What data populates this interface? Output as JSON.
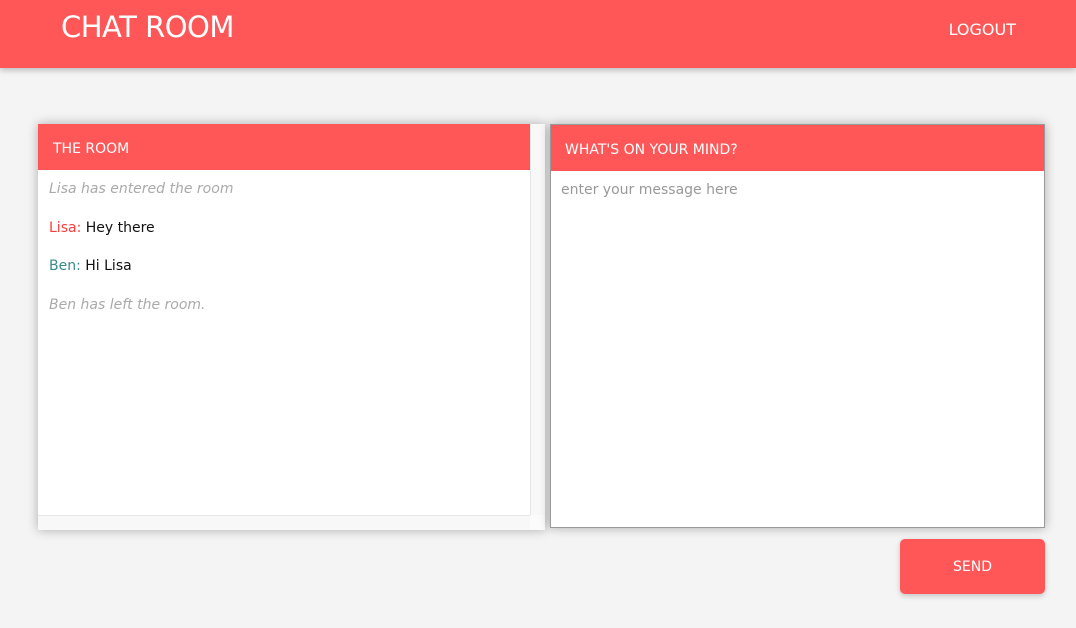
{
  "header": {
    "title": "CHAT ROOM",
    "logout_label": "LOGOUT"
  },
  "room": {
    "title": "THE ROOM",
    "messages": [
      {
        "type": "system",
        "text": "Lisa has entered the room"
      },
      {
        "type": "chat",
        "user": "Lisa:",
        "text": "Hey there",
        "color": "#ff3b3b"
      },
      {
        "type": "chat",
        "user": "Ben:",
        "text": "Hi Lisa",
        "color": "#3a8a8a"
      },
      {
        "type": "system",
        "text": "Ben has left the room."
      }
    ]
  },
  "compose": {
    "title": "WHAT'S ON YOUR MIND?",
    "placeholder": "enter your message here",
    "value": "",
    "send_label": "SEND"
  },
  "colors": {
    "accent": "#ff5757"
  }
}
